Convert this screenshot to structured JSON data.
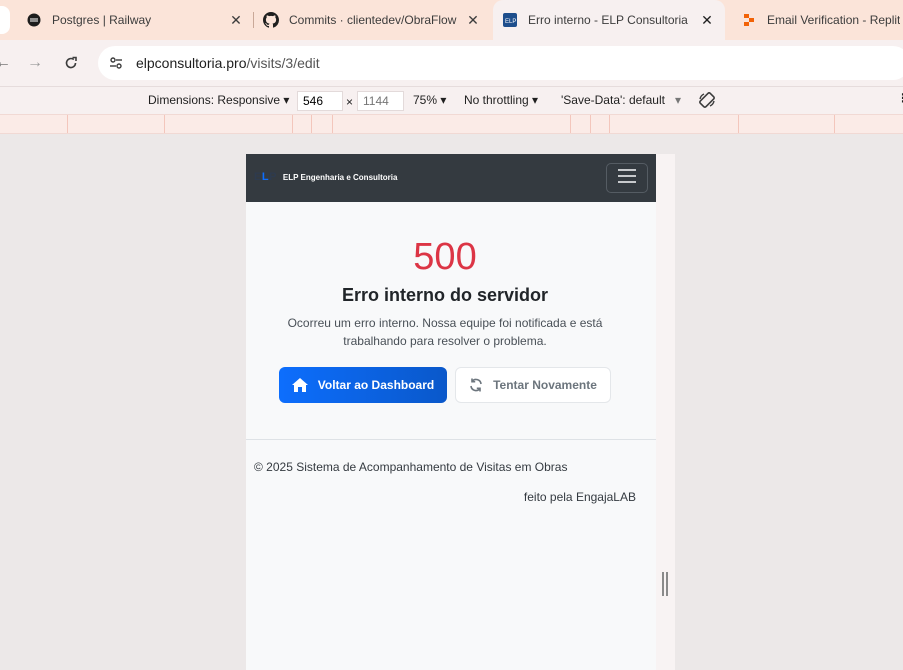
{
  "tabs": [
    {
      "title": "Postgres | Railway",
      "icon": "railway-icon"
    },
    {
      "title": "Commits · clientedev/ObraFlow",
      "icon": "github-icon"
    },
    {
      "title": "Erro interno - ELP Consultoria",
      "icon": "elp-favicon",
      "active": true
    },
    {
      "title": "Email Verification - Replit",
      "icon": "replit-icon"
    }
  ],
  "address": {
    "host": "elpconsultoria.pro",
    "path": "/visits/3/edit"
  },
  "devtools": {
    "dimensions_label": "Dimensions: Responsive",
    "width": "546",
    "times": "×",
    "height_placeholder": "1144",
    "zoom": "75%",
    "throttling": "No throttling",
    "save_data": "'Save-Data': default"
  },
  "page": {
    "brand_logo": "ELP",
    "brand_name": "ELP Engenharia e Consultoria",
    "error_code": "500",
    "error_title": "Erro interno do servidor",
    "error_message": "Ocorreu um erro interno. Nossa equipe foi notificada e está trabalhando para resolver o problema.",
    "primary_button": "Voltar ao Dashboard",
    "secondary_button": "Tentar Novamente",
    "footer_copyright": "© 2025 Sistema de Acompanhamento de Visitas em Obras",
    "footer_madeby": "feito pela EngajaLAB"
  },
  "colors": {
    "navbar": "#343a40",
    "error": "#dc3545",
    "primary": "#0d6efd",
    "tabstrip": "#fbe4d9"
  }
}
